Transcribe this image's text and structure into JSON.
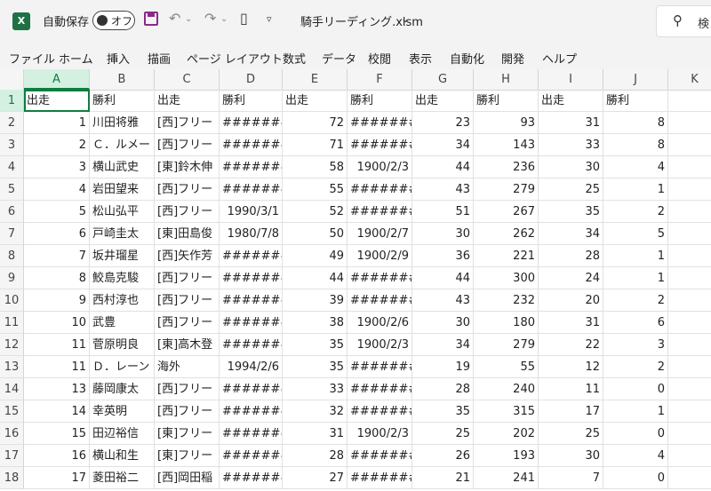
{
  "titlebar": {
    "app_icon": "X",
    "autosave_label": "自動保存",
    "toggle_label": "オフ",
    "doc_title": "騎手リーディング.xlsm",
    "chevron": "⌄",
    "search_text": "検"
  },
  "ribbon": {
    "tabs": [
      "ファイル",
      "ホーム",
      "挿入",
      "描画",
      "ページ レイアウト",
      "数式",
      "データ",
      "校閲",
      "表示",
      "自動化",
      "開発",
      "ヘルプ"
    ]
  },
  "columns": [
    "A",
    "B",
    "C",
    "D",
    "E",
    "F",
    "G",
    "H",
    "I",
    "J",
    "K"
  ],
  "rows": [
    {
      "n": "1",
      "cells": [
        "出走",
        "勝利",
        "出走",
        "勝利",
        "出走",
        "勝利",
        "出走",
        "勝利",
        "出走",
        "勝利",
        ""
      ]
    },
    {
      "n": "2",
      "cells": [
        "1",
        "川田将雅",
        "[西]フリー",
        "#######",
        "72",
        "#######",
        "23",
        "93",
        "31",
        "8",
        ""
      ]
    },
    {
      "n": "3",
      "cells": [
        "2",
        "Ｃ．ルメー",
        "[西]フリー",
        "#######",
        "71",
        "#######",
        "34",
        "143",
        "33",
        "8",
        ""
      ]
    },
    {
      "n": "4",
      "cells": [
        "3",
        "横山武史",
        "[東]鈴木伸",
        "#######",
        "58",
        "1900/2/3",
        "44",
        "236",
        "30",
        "4",
        ""
      ]
    },
    {
      "n": "5",
      "cells": [
        "4",
        "岩田望来",
        "[西]フリー",
        "#######",
        "55",
        "#######",
        "43",
        "279",
        "25",
        "1",
        ""
      ]
    },
    {
      "n": "6",
      "cells": [
        "5",
        "松山弘平",
        "[西]フリー",
        "1990/3/1",
        "52",
        "#######",
        "51",
        "267",
        "35",
        "2",
        ""
      ]
    },
    {
      "n": "7",
      "cells": [
        "6",
        "戸崎圭太",
        "[東]田島俊",
        "1980/7/8",
        "50",
        "1900/2/7",
        "30",
        "262",
        "34",
        "5",
        ""
      ]
    },
    {
      "n": "8",
      "cells": [
        "7",
        "坂井瑠星",
        "[西]矢作芳",
        "#######",
        "49",
        "1900/2/9",
        "36",
        "221",
        "28",
        "1",
        ""
      ]
    },
    {
      "n": "9",
      "cells": [
        "8",
        "鮫島克駿",
        "[西]フリー",
        "#######",
        "44",
        "#######",
        "44",
        "300",
        "24",
        "1",
        ""
      ]
    },
    {
      "n": "10",
      "cells": [
        "9",
        "西村淳也",
        "[西]フリー",
        "#######",
        "39",
        "#######",
        "43",
        "232",
        "20",
        "2",
        ""
      ]
    },
    {
      "n": "11",
      "cells": [
        "10",
        "武豊",
        "[西]フリー",
        "#######",
        "38",
        "1900/2/6",
        "30",
        "180",
        "31",
        "6",
        ""
      ]
    },
    {
      "n": "12",
      "cells": [
        "11",
        "菅原明良",
        "[東]高木登",
        "#######",
        "35",
        "1900/2/3",
        "34",
        "279",
        "22",
        "3",
        ""
      ]
    },
    {
      "n": "13",
      "cells": [
        "11",
        "Ｄ．レーン",
        "海外",
        "1994/2/6",
        "35",
        "#######",
        "19",
        "55",
        "12",
        "2",
        ""
      ]
    },
    {
      "n": "14",
      "cells": [
        "13",
        "藤岡康太",
        "[西]フリー",
        "#######",
        "33",
        "#######",
        "28",
        "240",
        "11",
        "0",
        ""
      ]
    },
    {
      "n": "15",
      "cells": [
        "14",
        "幸英明",
        "[西]フリー",
        "#######",
        "32",
        "#######",
        "35",
        "315",
        "17",
        "1",
        ""
      ]
    },
    {
      "n": "16",
      "cells": [
        "15",
        "田辺裕信",
        "[東]フリー",
        "#######",
        "31",
        "1900/2/3",
        "25",
        "202",
        "25",
        "0",
        ""
      ]
    },
    {
      "n": "17",
      "cells": [
        "16",
        "横山和生",
        "[東]フリー",
        "#######",
        "28",
        "#######",
        "26",
        "193",
        "30",
        "4",
        ""
      ]
    },
    {
      "n": "18",
      "cells": [
        "17",
        "菱田裕二",
        "[西]岡田稲",
        "#######",
        "27",
        "#######",
        "21",
        "241",
        "7",
        "0",
        ""
      ]
    }
  ],
  "numeric_columns": [
    0,
    4,
    6,
    7,
    8,
    9
  ],
  "centered_hash_columns": [
    3,
    5
  ]
}
